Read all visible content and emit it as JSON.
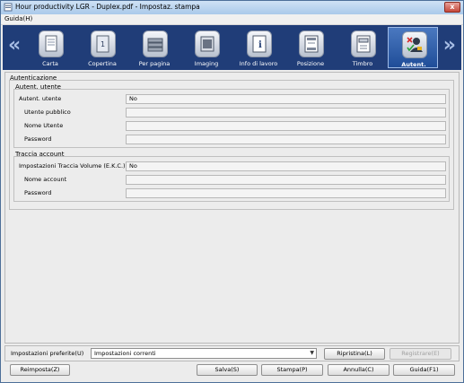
{
  "window": {
    "title": "Hour productivity LGR - Duplex.pdf - Impostaz. stampa",
    "close_glyph": "x"
  },
  "menu": {
    "guida": "Guida(H)"
  },
  "ribbon": {
    "prev_glyph": "«",
    "next_glyph": "»",
    "tabs": [
      {
        "label": "Carta",
        "icon": "paper-icon"
      },
      {
        "label": "Copertina",
        "icon": "cover-icon"
      },
      {
        "label": "Per pagina",
        "icon": "per-page-icon"
      },
      {
        "label": "Imaging",
        "icon": "imaging-icon"
      },
      {
        "label": "Info di lavoro",
        "icon": "job-info-icon"
      },
      {
        "label": "Posizione",
        "icon": "position-icon"
      },
      {
        "label": "Timbro",
        "icon": "stamp-icon"
      },
      {
        "label": "Autent.",
        "icon": "authentication-icon",
        "active": true
      }
    ]
  },
  "auth": {
    "group_title": "Autenticazione",
    "user_auth": {
      "title": "Autent. utente",
      "rows": [
        {
          "label": "Autent. utente",
          "value": "No"
        },
        {
          "label": "Utente pubblico",
          "value": ""
        },
        {
          "label": "Nome Utente",
          "value": ""
        },
        {
          "label": "Password",
          "value": ""
        }
      ]
    },
    "account_track": {
      "title": "Traccia account",
      "rows": [
        {
          "label": "Impostazioni Traccia Volume (E.K.C.)",
          "value": "No"
        },
        {
          "label": "Nome account",
          "value": ""
        },
        {
          "label": "Password",
          "value": ""
        }
      ]
    }
  },
  "favorites": {
    "label": "Impostazioni preferite(U)",
    "selected": "Impostazioni correnti",
    "restore": "Ripristina(L)",
    "register": "Registrare(E)"
  },
  "footer": {
    "reset": "Reimposta(Z)",
    "save": "Salva(S)",
    "print": "Stampa(P)",
    "cancel": "Annulla(C)",
    "help": "Guida(F1)"
  },
  "colors": {
    "ribbon": "#203d78",
    "active_tab": "#2f5fa8",
    "window_bg": "#ececec"
  }
}
